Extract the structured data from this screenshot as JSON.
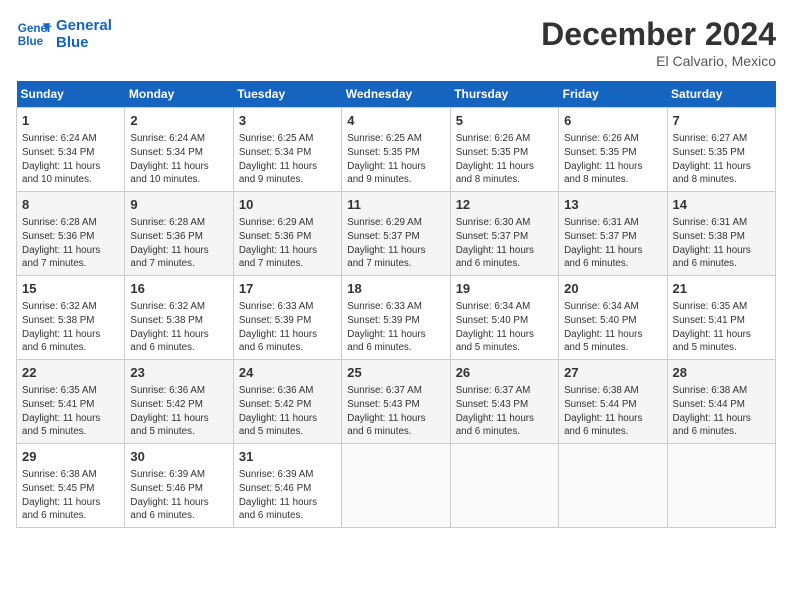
{
  "header": {
    "logo_line1": "General",
    "logo_line2": "Blue",
    "month": "December 2024",
    "location": "El Calvario, Mexico"
  },
  "days_of_week": [
    "Sunday",
    "Monday",
    "Tuesday",
    "Wednesday",
    "Thursday",
    "Friday",
    "Saturday"
  ],
  "weeks": [
    [
      {
        "day": "1",
        "info": "Sunrise: 6:24 AM\nSunset: 5:34 PM\nDaylight: 11 hours\nand 10 minutes."
      },
      {
        "day": "2",
        "info": "Sunrise: 6:24 AM\nSunset: 5:34 PM\nDaylight: 11 hours\nand 10 minutes."
      },
      {
        "day": "3",
        "info": "Sunrise: 6:25 AM\nSunset: 5:34 PM\nDaylight: 11 hours\nand 9 minutes."
      },
      {
        "day": "4",
        "info": "Sunrise: 6:25 AM\nSunset: 5:35 PM\nDaylight: 11 hours\nand 9 minutes."
      },
      {
        "day": "5",
        "info": "Sunrise: 6:26 AM\nSunset: 5:35 PM\nDaylight: 11 hours\nand 8 minutes."
      },
      {
        "day": "6",
        "info": "Sunrise: 6:26 AM\nSunset: 5:35 PM\nDaylight: 11 hours\nand 8 minutes."
      },
      {
        "day": "7",
        "info": "Sunrise: 6:27 AM\nSunset: 5:35 PM\nDaylight: 11 hours\nand 8 minutes."
      }
    ],
    [
      {
        "day": "8",
        "info": "Sunrise: 6:28 AM\nSunset: 5:36 PM\nDaylight: 11 hours\nand 7 minutes."
      },
      {
        "day": "9",
        "info": "Sunrise: 6:28 AM\nSunset: 5:36 PM\nDaylight: 11 hours\nand 7 minutes."
      },
      {
        "day": "10",
        "info": "Sunrise: 6:29 AM\nSunset: 5:36 PM\nDaylight: 11 hours\nand 7 minutes."
      },
      {
        "day": "11",
        "info": "Sunrise: 6:29 AM\nSunset: 5:37 PM\nDaylight: 11 hours\nand 7 minutes."
      },
      {
        "day": "12",
        "info": "Sunrise: 6:30 AM\nSunset: 5:37 PM\nDaylight: 11 hours\nand 6 minutes."
      },
      {
        "day": "13",
        "info": "Sunrise: 6:31 AM\nSunset: 5:37 PM\nDaylight: 11 hours\nand 6 minutes."
      },
      {
        "day": "14",
        "info": "Sunrise: 6:31 AM\nSunset: 5:38 PM\nDaylight: 11 hours\nand 6 minutes."
      }
    ],
    [
      {
        "day": "15",
        "info": "Sunrise: 6:32 AM\nSunset: 5:38 PM\nDaylight: 11 hours\nand 6 minutes."
      },
      {
        "day": "16",
        "info": "Sunrise: 6:32 AM\nSunset: 5:38 PM\nDaylight: 11 hours\nand 6 minutes."
      },
      {
        "day": "17",
        "info": "Sunrise: 6:33 AM\nSunset: 5:39 PM\nDaylight: 11 hours\nand 6 minutes."
      },
      {
        "day": "18",
        "info": "Sunrise: 6:33 AM\nSunset: 5:39 PM\nDaylight: 11 hours\nand 6 minutes."
      },
      {
        "day": "19",
        "info": "Sunrise: 6:34 AM\nSunset: 5:40 PM\nDaylight: 11 hours\nand 5 minutes."
      },
      {
        "day": "20",
        "info": "Sunrise: 6:34 AM\nSunset: 5:40 PM\nDaylight: 11 hours\nand 5 minutes."
      },
      {
        "day": "21",
        "info": "Sunrise: 6:35 AM\nSunset: 5:41 PM\nDaylight: 11 hours\nand 5 minutes."
      }
    ],
    [
      {
        "day": "22",
        "info": "Sunrise: 6:35 AM\nSunset: 5:41 PM\nDaylight: 11 hours\nand 5 minutes."
      },
      {
        "day": "23",
        "info": "Sunrise: 6:36 AM\nSunset: 5:42 PM\nDaylight: 11 hours\nand 5 minutes."
      },
      {
        "day": "24",
        "info": "Sunrise: 6:36 AM\nSunset: 5:42 PM\nDaylight: 11 hours\nand 5 minutes."
      },
      {
        "day": "25",
        "info": "Sunrise: 6:37 AM\nSunset: 5:43 PM\nDaylight: 11 hours\nand 6 minutes."
      },
      {
        "day": "26",
        "info": "Sunrise: 6:37 AM\nSunset: 5:43 PM\nDaylight: 11 hours\nand 6 minutes."
      },
      {
        "day": "27",
        "info": "Sunrise: 6:38 AM\nSunset: 5:44 PM\nDaylight: 11 hours\nand 6 minutes."
      },
      {
        "day": "28",
        "info": "Sunrise: 6:38 AM\nSunset: 5:44 PM\nDaylight: 11 hours\nand 6 minutes."
      }
    ],
    [
      {
        "day": "29",
        "info": "Sunrise: 6:38 AM\nSunset: 5:45 PM\nDaylight: 11 hours\nand 6 minutes."
      },
      {
        "day": "30",
        "info": "Sunrise: 6:39 AM\nSunset: 5:46 PM\nDaylight: 11 hours\nand 6 minutes."
      },
      {
        "day": "31",
        "info": "Sunrise: 6:39 AM\nSunset: 5:46 PM\nDaylight: 11 hours\nand 6 minutes."
      },
      {
        "day": "",
        "info": ""
      },
      {
        "day": "",
        "info": ""
      },
      {
        "day": "",
        "info": ""
      },
      {
        "day": "",
        "info": ""
      }
    ]
  ]
}
